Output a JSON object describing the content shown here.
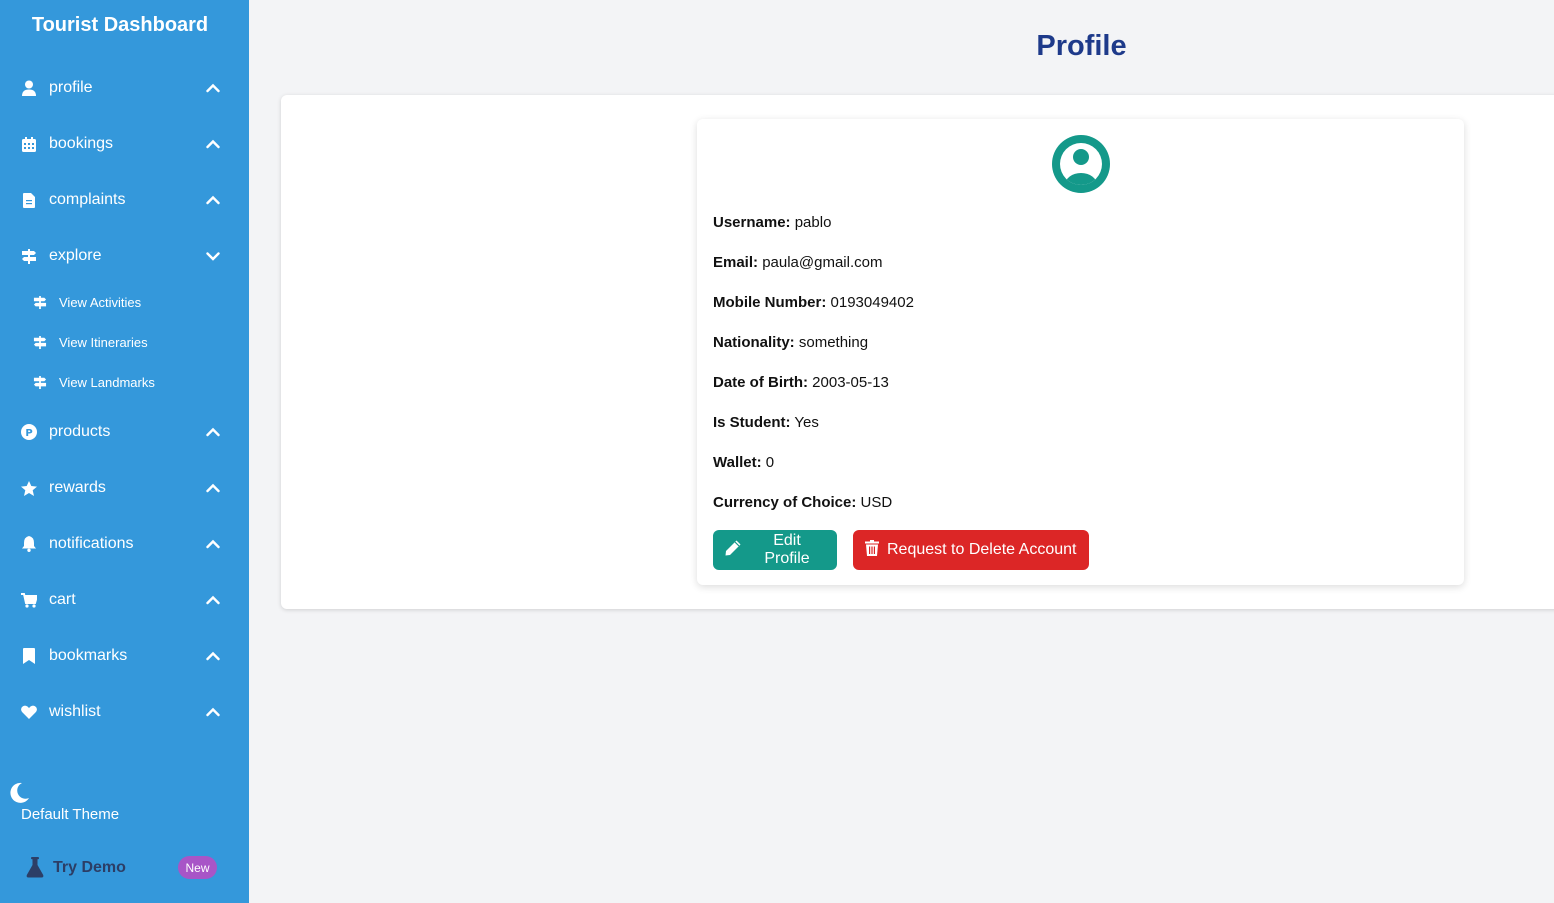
{
  "sidebar": {
    "title": "Tourist Dashboard",
    "items": [
      {
        "label": "profile",
        "icon": "user-icon"
      },
      {
        "label": "bookings",
        "icon": "calendar-icon"
      },
      {
        "label": "complaints",
        "icon": "file-icon"
      },
      {
        "label": "explore",
        "icon": "signpost-icon"
      },
      {
        "label": "products",
        "icon": "product-p-icon"
      },
      {
        "label": "rewards",
        "icon": "star-icon"
      },
      {
        "label": "notifications",
        "icon": "bell-icon"
      },
      {
        "label": "cart",
        "icon": "cart-icon"
      },
      {
        "label": "bookmarks",
        "icon": "bookmark-icon"
      },
      {
        "label": "wishlist",
        "icon": "heart-icon"
      }
    ],
    "explore_sub": [
      {
        "label": "View Activities"
      },
      {
        "label": "View Itineraries"
      },
      {
        "label": "View Landmarks"
      }
    ],
    "theme_label": "Default Theme",
    "demo_label": "Try Demo",
    "demo_badge": "New"
  },
  "main": {
    "title": "Profile",
    "fields": [
      {
        "label": "Username:",
        "value": "pablo"
      },
      {
        "label": "Email:",
        "value": "paula@gmail.com"
      },
      {
        "label": "Mobile Number:",
        "value": "0193049402"
      },
      {
        "label": "Nationality:",
        "value": "something"
      },
      {
        "label": "Date of Birth:",
        "value": "2003-05-13"
      },
      {
        "label": "Is Student:",
        "value": "Yes"
      },
      {
        "label": "Wallet:",
        "value": "0"
      },
      {
        "label": "Currency of Choice:",
        "value": "USD"
      }
    ],
    "edit_label": "Edit Profile",
    "delete_label": "Request to Delete Account"
  },
  "colors": {
    "sidebar": "#3498db",
    "title": "#1e3a8a",
    "edit": "#14998a",
    "delete": "#dc2626",
    "badge": "#a855c7"
  }
}
